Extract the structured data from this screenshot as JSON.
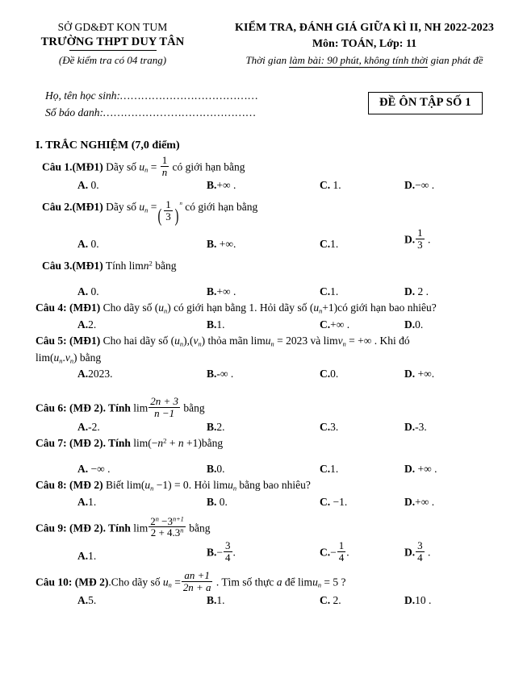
{
  "header": {
    "left": {
      "department": "SỞ GD&ĐT KON TUM",
      "school": "TRƯỜNG THPT DUY TÂN",
      "pages_note": "(Đề kiểm tra có 04 trang)"
    },
    "right": {
      "title": "KIỂM TRA, ĐÁNH GIÁ GIỮA KÌ II, NH 2022-2023",
      "subject": "Môn: TOÁN,  Lớp: 11",
      "time_prefix": "Thời gian ",
      "time_underlined": "làm bài: 90 phút, không tính thời",
      "time_suffix": " gian phát đề"
    }
  },
  "student_info": {
    "name_label": "Họ, tên học sinh:",
    "name_dots": "…………………………………",
    "id_label": "Số báo danh:",
    "id_dots": "……………....……………………",
    "exam_code": "ĐỀ ÔN TẬP SỐ 1"
  },
  "section": {
    "title": "I. TRẮC NGHIỆM (7,0 điểm)"
  },
  "questions": [
    {
      "number": "Câu 1.(MĐ1)",
      "text_before": "Dãy số",
      "text_after": "có giới hạn bằng",
      "options": [
        {
          "letter": "A.",
          "value": " 0."
        },
        {
          "letter": "B.",
          "value": "+∞ ."
        },
        {
          "letter": "C.",
          "value": " 1."
        },
        {
          "letter": "D.",
          "value": "−∞ ."
        }
      ]
    },
    {
      "number": "Câu 2.(MĐ1)",
      "text_before": "Dãy số",
      "text_after": "có giới hạn bằng",
      "options": [
        {
          "letter": "A.",
          "value": " 0."
        },
        {
          "letter": "B.",
          "value": " +∞."
        },
        {
          "letter": "C.",
          "value": "1."
        },
        {
          "letter": "D.",
          "value": ""
        }
      ]
    },
    {
      "number": "Câu 3.(MĐ1)",
      "text_before": "Tính",
      "text_after": "bằng",
      "options": [
        {
          "letter": "A.",
          "value": " 0."
        },
        {
          "letter": "B.",
          "value": "+∞ ."
        },
        {
          "letter": "C.",
          "value": "1."
        },
        {
          "letter": "D.",
          "value": " 2 ."
        }
      ]
    },
    {
      "number": "Câu 4: (MĐ1)",
      "text_before": "Cho dãy số",
      "text_mid": "có giới hạn bằng 1. Hỏi dãy số",
      "text_after": "có giới hạn bao nhiêu?",
      "options": [
        {
          "letter": "A.",
          "value": "2."
        },
        {
          "letter": "B.",
          "value": "1."
        },
        {
          "letter": "C.",
          "value": "+∞ ."
        },
        {
          "letter": "D.",
          "value": "0."
        }
      ]
    },
    {
      "number": "Câu 5: (MĐ1)",
      "text_before": "Cho hai dãy số",
      "text_mid": "thỏa mãn",
      "text_val1": "= 2023",
      "text_and": " và ",
      "text_val2": "= +∞",
      "text_after": ". Khi đó",
      "line2_after": "bằng",
      "options": [
        {
          "letter": "A.",
          "value": "2023."
        },
        {
          "letter": "B.",
          "value": "-∞ ."
        },
        {
          "letter": "C.",
          "value": "0."
        },
        {
          "letter": "D.",
          "value": " +∞."
        }
      ]
    },
    {
      "number": "Câu 6: (MĐ 2)",
      "text_before": ". Tính",
      "text_after": "bằng",
      "options": [
        {
          "letter": "A.",
          "value": "-2."
        },
        {
          "letter": "B.",
          "value": "2."
        },
        {
          "letter": "C.",
          "value": "3."
        },
        {
          "letter": "D.",
          "value": "-3."
        }
      ]
    },
    {
      "number": "Câu 7: (MĐ 2)",
      "text_before": ". Tính",
      "text_after": "bằng",
      "options": [
        {
          "letter": "A.",
          "value": " −∞ ."
        },
        {
          "letter": "B.",
          "value": "0."
        },
        {
          "letter": "C.",
          "value": "1."
        },
        {
          "letter": "D.",
          "value": " +∞ ."
        }
      ]
    },
    {
      "number": "Câu 8: (MĐ 2)",
      "text_before": "Biết",
      "text_mid": "= 0",
      "text_after": ". Hỏi",
      "text_end": "bằng  bao nhiêu?",
      "options": [
        {
          "letter": "A.",
          "value": "1."
        },
        {
          "letter": "B.",
          "value": " 0."
        },
        {
          "letter": "C.",
          "value": " −1."
        },
        {
          "letter": "D.",
          "value": "+∞ ."
        }
      ]
    },
    {
      "number": "Câu 9: (MĐ 2)",
      "text_before": ". Tính",
      "text_after": "bằng",
      "options": [
        {
          "letter": "A.",
          "value": "1."
        },
        {
          "letter": "B.",
          "value": ""
        },
        {
          "letter": "C.",
          "value": ""
        },
        {
          "letter": "D.",
          "value": ""
        }
      ]
    },
    {
      "number": "Câu 10: (MĐ 2)",
      "text_before": ".Cho dãy số",
      "text_after": ". Tìm số thực",
      "text_var": "a",
      "text_end": "để",
      "text_eq": "= 5 ?",
      "options": [
        {
          "letter": "A.",
          "value": "5."
        },
        {
          "letter": "B.",
          "value": "1."
        },
        {
          "letter": "C.",
          "value": " 2."
        },
        {
          "letter": "D.",
          "value": "10 ."
        }
      ]
    }
  ],
  "math": {
    "q1_un": "u",
    "q1_sub": "n",
    "q1_eq": "=",
    "q1_num": "1",
    "q1_den": "n",
    "q2_num": "1",
    "q2_den": "3",
    "q2_exp": "n",
    "q3_lim": "lim",
    "q3_n": "n",
    "q3_exp": "2",
    "q4_u": "u",
    "q4_plus1": "+1",
    "q5_u": "u",
    "q5_v": "v",
    "q5_lim": "lim",
    "q6_num": "2n + 3",
    "q6_den": "n −1",
    "q7_expr": "lim(−n² + n +1)",
    "q8_expr": "lim(u − 1)",
    "q9_num_base": "2",
    "q9_num_exp": "n",
    "q9_num_sub": "−3",
    "q9_num_exp2": "n+1",
    "q9_den": "2 + 4.3",
    "q9_den_exp": "n",
    "q9_b_num": "3",
    "q9_b_den": "4",
    "q9_c_num": "1",
    "q9_c_den": "4",
    "q9_d_num": "3",
    "q9_d_den": "4",
    "q10_num": "an +1",
    "q10_den": "2n + a"
  }
}
